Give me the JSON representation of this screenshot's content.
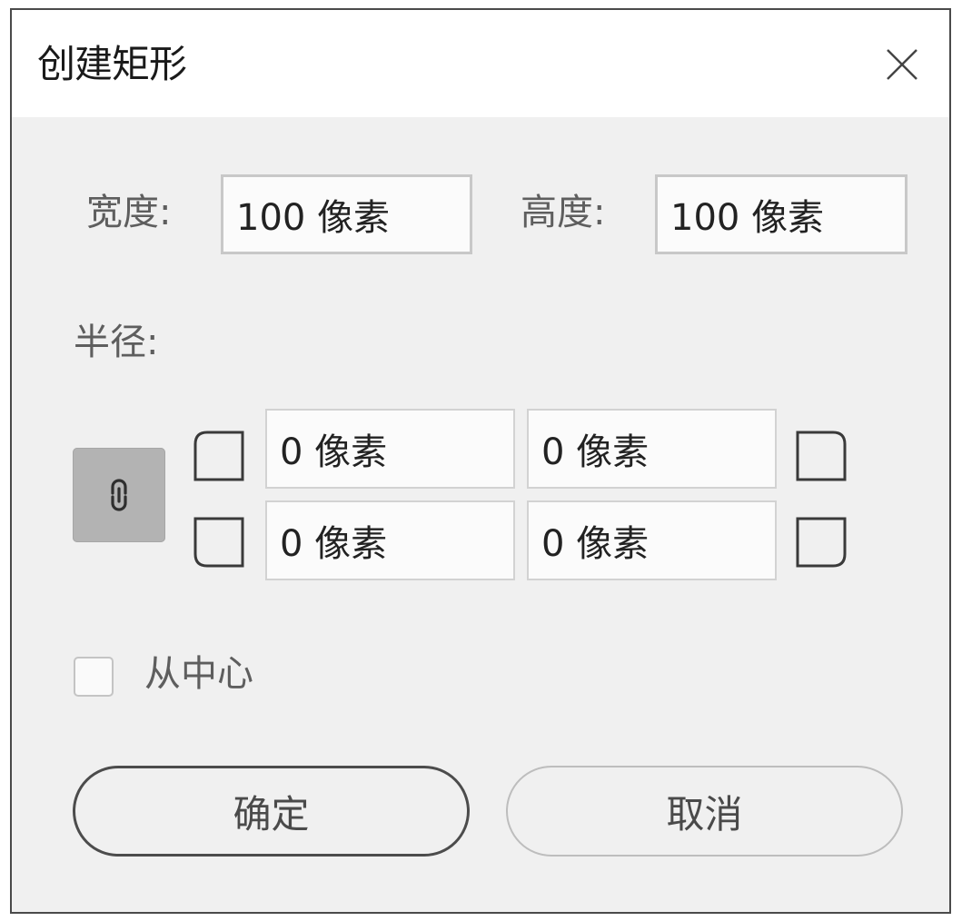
{
  "dialog": {
    "title": "创建矩形",
    "close_icon": "close-icon"
  },
  "size": {
    "width_label": "宽度:",
    "width_value": "100 像素",
    "height_label": "高度:",
    "height_value": "100 像素"
  },
  "radius": {
    "label": "半径:",
    "link_icon": "link-icon",
    "top_left": "0 像素",
    "top_right": "0 像素",
    "bottom_left": "0 像素",
    "bottom_right": "0 像素",
    "corner_icons": [
      "corner-top-left-icon",
      "corner-top-right-icon",
      "corner-bottom-left-icon",
      "corner-bottom-right-icon"
    ]
  },
  "from_center": {
    "label": "从中心",
    "checked": false
  },
  "buttons": {
    "ok": "确定",
    "cancel": "取消"
  }
}
